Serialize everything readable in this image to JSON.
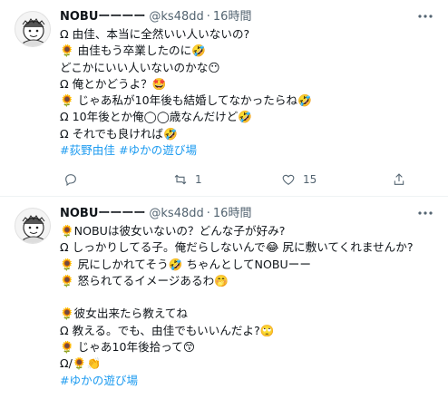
{
  "tweets": [
    {
      "name": "NOBUーーーー",
      "handle": "@ks48dd",
      "separator": "·",
      "time": "16時間",
      "lines": [
        "Ω 由佳、本当に全然いい人いないの?",
        "🌻 由佳もう卒業したのに🤣",
        "どこかにいい人いないのかな😶",
        "Ω 俺とかどうよ？🤩",
        "🌻 じゃあ私が10年後も結婚してなかったらね🤣",
        "Ω 10年後とか俺◯◯歳なんだけど🤣",
        "Ω それでも良ければ🤣"
      ],
      "hashtags": [
        "#荻野由佳",
        "#ゆかの遊び場"
      ],
      "actions": {
        "replies": "",
        "retweets": "1",
        "likes": "15"
      }
    },
    {
      "name": "NOBUーーーー",
      "handle": "@ks48dd",
      "separator": "·",
      "time": "16時間",
      "lines": [
        "🌻NOBUは彼女いないの？どんな子が好み?",
        "Ω しっかりしてる子。俺だらしないんで😂 尻に敷いてくれませんか?",
        "🌻 尻にしかれてそう🤣  ちゃんとしてNOBUーー",
        "🌻 怒られてるイメージあるわ🤭",
        "",
        "🌻彼女出来たら教えてね",
        "Ω 教える。でも、由佳でもいいんだよ?🙄",
        "🌻 じゃあ10年後拾って😙",
        "Ω/🌻👏"
      ],
      "hashtags": [
        "#ゆかの遊び場"
      ]
    }
  ],
  "icons": [
    "more-icon",
    "reply-icon",
    "retweet-icon",
    "like-icon",
    "share-icon"
  ],
  "colors": {
    "link": "#1d9bf0",
    "secondary": "#536471",
    "text": "#0f1419",
    "divider": "#eff3f4"
  }
}
